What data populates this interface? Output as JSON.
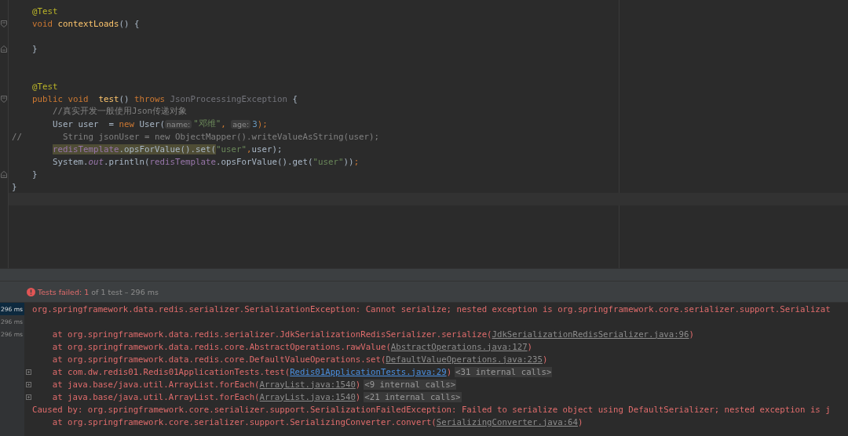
{
  "editor": {
    "lines": [
      {
        "tokens": [
          {
            "kind": "annotation",
            "text": "    @Test"
          }
        ]
      },
      {
        "fold_start": true,
        "tokens": [
          {
            "kind": "keyword",
            "text": "    void "
          },
          {
            "kind": "method",
            "text": "contextLoads"
          },
          {
            "kind": "plain",
            "text": "() {"
          }
        ]
      },
      {
        "kind": "blank"
      },
      {
        "fold_end": true,
        "tokens": [
          {
            "kind": "plain",
            "text": "    }"
          }
        ]
      },
      {
        "kind": "blank"
      },
      {
        "kind": "blank"
      },
      {
        "tokens": [
          {
            "kind": "annotation",
            "text": "    @Test"
          }
        ]
      },
      {
        "fold_start": true,
        "tokens": [
          {
            "kind": "keyword",
            "text": "    public void  "
          },
          {
            "kind": "method",
            "text": "test"
          },
          {
            "kind": "plain",
            "text": "() "
          },
          {
            "kind": "keyword",
            "text": "throws "
          },
          {
            "kind": "unused",
            "text": "JsonProcessingException "
          },
          {
            "kind": "plain",
            "text": "{"
          }
        ]
      },
      {
        "tokens": [
          {
            "kind": "comment",
            "text": "        //真实开发一般使用Json传递对象"
          }
        ]
      },
      {
        "tokens": [
          {
            "kind": "plain",
            "text": "        User user  = "
          },
          {
            "kind": "keyword",
            "text": "new "
          },
          {
            "kind": "plain",
            "text": "User("
          },
          {
            "kind": "hint",
            "text": "name:"
          },
          {
            "kind": "string",
            "text": "\"邓维\""
          },
          {
            "kind": "keyword",
            "text": ", "
          },
          {
            "kind": "hint",
            "text": "age:"
          },
          {
            "kind": "number",
            "text": "3"
          },
          {
            "kind": "keyword",
            "text": ");"
          }
        ]
      },
      {
        "tokens": [
          {
            "kind": "comment",
            "text": "//        String jsonUser = new ObjectMapper().writeValueAsString(user);"
          }
        ]
      },
      {
        "tokens": [
          {
            "kind": "field",
            "text": "        redisTemplate",
            "marked": true
          },
          {
            "kind": "plain",
            "text": ".opsForValue().set(",
            "marked": true
          },
          {
            "kind": "string",
            "text": "\"user\""
          },
          {
            "kind": "keyword",
            "text": ","
          },
          {
            "kind": "plain",
            "text": "user);"
          }
        ]
      },
      {
        "tokens": [
          {
            "kind": "plain",
            "text": "        System."
          },
          {
            "kind": "static",
            "text": "out"
          },
          {
            "kind": "plain",
            "text": ".println("
          },
          {
            "kind": "field",
            "text": "redisTemplate"
          },
          {
            "kind": "plain",
            "text": ".opsForValue().get("
          },
          {
            "kind": "string",
            "text": "\"user\""
          },
          {
            "kind": "plain",
            "text": "))"
          },
          {
            "kind": "keyword",
            "text": ";"
          }
        ]
      },
      {
        "fold_end": true,
        "tokens": [
          {
            "kind": "plain",
            "text": "    }"
          }
        ]
      },
      {
        "tokens": [
          {
            "kind": "plain",
            "text": "}"
          }
        ]
      },
      {
        "kind": "blank",
        "current": true
      }
    ]
  },
  "test_results": {
    "status": "Tests failed: 1",
    "detail": "of 1 test – 296 ms"
  },
  "durations": [
    {
      "text": "296 ms",
      "selected": true
    },
    {
      "text": "296 ms",
      "selected": false
    },
    {
      "text": "296 ms",
      "selected": false
    }
  ],
  "console": [
    {
      "kind": "error",
      "text": "org.springframework.data.redis.serializer.SerializationException: Cannot serialize; nested exception is org.springframework.core.serializer.support.Serializat"
    },
    {
      "kind": "blank"
    },
    {
      "kind": "frame",
      "text": "    at org.springframework.data.redis.serializer.JdkSerializationRedisSerializer.serialize(",
      "link": {
        "text": "JdkSerializationRedisSerializer.java:96",
        "kind": "library"
      },
      "tail": ")"
    },
    {
      "kind": "frame",
      "text": "    at org.springframework.data.redis.core.AbstractOperations.rawValue(",
      "link": {
        "text": "AbstractOperations.java:127",
        "kind": "library"
      },
      "tail": ")"
    },
    {
      "kind": "frame",
      "text": "    at org.springframework.data.redis.core.DefaultValueOperations.set(",
      "link": {
        "text": "DefaultValueOperations.java:235",
        "kind": "library"
      },
      "tail": ")"
    },
    {
      "kind": "frame",
      "collapsible": true,
      "text": "    at com.dw.redis01.Redis01ApplicationTests.test(",
      "link": {
        "text": "Redis01ApplicationTests.java:29",
        "kind": "project"
      },
      "tail": ")",
      "badge": "<31 internal calls>"
    },
    {
      "kind": "frame",
      "collapsible": true,
      "text": "    at java.base/java.util.ArrayList.forEach(",
      "link": {
        "text": "ArrayList.java:1540",
        "kind": "library"
      },
      "tail": ")",
      "badge": "<9 internal calls>"
    },
    {
      "kind": "frame",
      "collapsible": true,
      "text": "    at java.base/java.util.ArrayList.forEach(",
      "link": {
        "text": "ArrayList.java:1540",
        "kind": "library"
      },
      "tail": ")",
      "badge": "<21 internal calls>"
    },
    {
      "kind": "error",
      "text": "Caused by: org.springframework.core.serializer.support.SerializationFailedException: Failed to serialize object using DefaultSerializer; nested exception is j"
    },
    {
      "kind": "frame",
      "text": "    at org.springframework.core.serializer.support.SerializingConverter.convert(",
      "link": {
        "text": "SerializingConverter.java:64",
        "kind": "library"
      },
      "tail": ")"
    }
  ]
}
